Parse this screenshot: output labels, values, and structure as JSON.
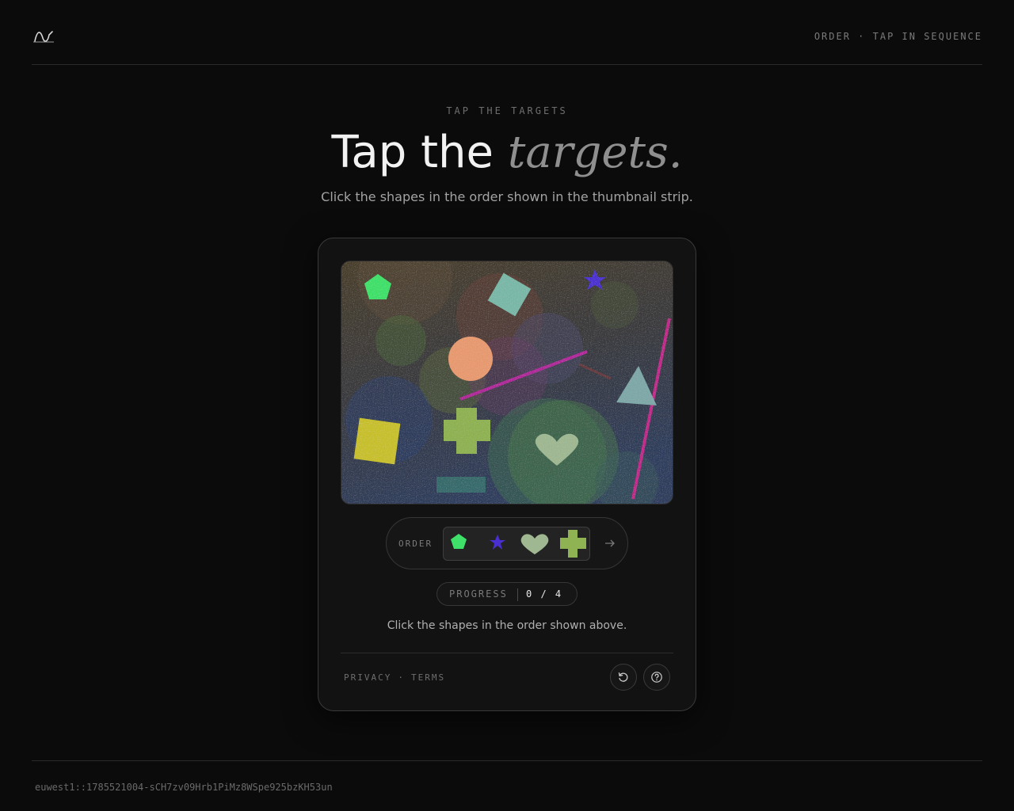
{
  "header": {
    "logo_icon": "wave-logo-icon",
    "tag": "ORDER · TAP IN SEQUENCE"
  },
  "hero": {
    "eyebrow": "TAP THE TARGETS",
    "title_plain": "Tap the",
    "title_italic": "targets.",
    "subtitle": "Click the shapes in the order shown in the thumbnail strip."
  },
  "challenge": {
    "shapes": [
      {
        "name": "pentagon",
        "color": "#3fe06a"
      },
      {
        "name": "star",
        "color": "#4a2fd0"
      },
      {
        "name": "heart",
        "color": "#9fb892"
      },
      {
        "name": "cross",
        "color": "#8fb252"
      },
      {
        "name": "diamond",
        "color": "#7ab8a8"
      },
      {
        "name": "circle",
        "color": "#e89a70"
      },
      {
        "name": "triangle",
        "color": "#7fa8a8"
      },
      {
        "name": "square",
        "color": "#c8c02a"
      }
    ],
    "order_label": "ORDER",
    "order": [
      "pentagon",
      "star",
      "heart",
      "cross"
    ],
    "next_icon": "arrow-right-icon",
    "progress_label": "PROGRESS",
    "progress_value": "0 / 4",
    "progress": {
      "done": 0,
      "total": 4
    },
    "instruction": "Click the shapes in the order shown above."
  },
  "footer": {
    "privacy": "PRIVACY",
    "separator": "·",
    "terms": "TERMS",
    "refresh_icon": "refresh-icon",
    "help_icon": "help-icon"
  },
  "session_id": "euwest1::1785521004-sCH7zv09Hrb1PiMz8WSpe925bzKH53un"
}
